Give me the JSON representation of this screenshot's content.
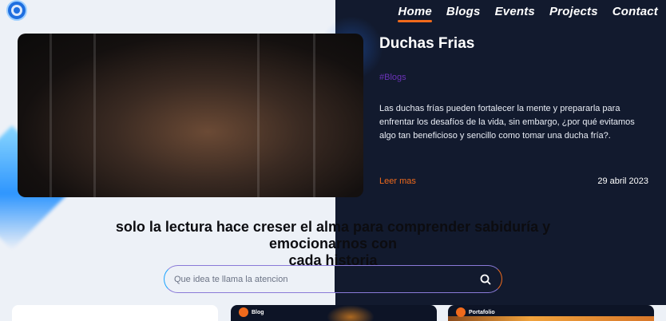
{
  "nav": {
    "items": [
      {
        "label": "Home",
        "active": true
      },
      {
        "label": "Blogs",
        "active": false
      },
      {
        "label": "Events",
        "active": false
      },
      {
        "label": "Projects",
        "active": false
      },
      {
        "label": "Contact",
        "active": false
      }
    ]
  },
  "hero": {
    "title": "Duchas Frias",
    "tag": "#Blogs",
    "description": "Las duchas frías pueden fortalecer la mente y prepararla para enfrentar los desafíos de la vida, sin embargo, ¿por qué evitamos algo tan beneficioso y sencillo como tomar una ducha fría?.",
    "read_more": "Leer mas",
    "date": "29 abril 2023"
  },
  "quote": {
    "line1": "solo la lectura hace creser el alma para comprender sabiduría y emocionarnos con",
    "line2": "cada historia"
  },
  "search": {
    "placeholder": "Que idea te llama la atencion"
  },
  "cards": [
    {
      "label": ""
    },
    {
      "label": "Blog"
    },
    {
      "label": "Portafolio"
    }
  ],
  "colors": {
    "accent": "#f06a1c",
    "dark": "#121a2e",
    "light": "#edf1f7",
    "tag": "#6b33b8",
    "search_border": "#1aa3ff"
  },
  "icons": {
    "logo": "lion-logo-icon",
    "search": "search-icon"
  }
}
